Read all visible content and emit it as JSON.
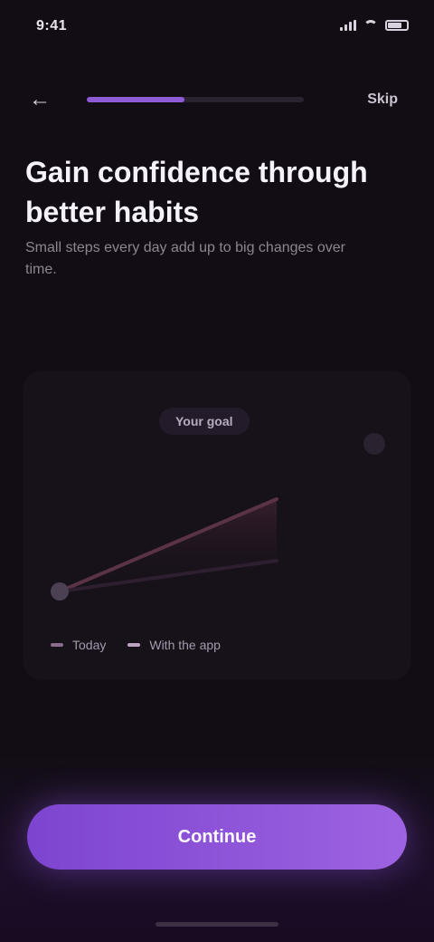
{
  "status_bar": {
    "time": "9:41",
    "icons": [
      "signal-icon",
      "wifi-icon",
      "battery-icon"
    ]
  },
  "header": {
    "back_icon": "arrow-left-icon",
    "progress_fraction": 0.45,
    "skip_label": "Skip"
  },
  "headline": {
    "title": "Gain confidence through better habits",
    "subtitle": "Small steps every day add up to big changes over time."
  },
  "chart": {
    "goal_label": "Your goal",
    "legend": [
      {
        "label": "Today",
        "color": "#8a6c8c"
      },
      {
        "label": "With the app",
        "color": "#b9a5c2"
      }
    ]
  },
  "chart_data": {
    "type": "line",
    "title": "",
    "xlabel": "",
    "ylabel": "",
    "series": [
      {
        "name": "Today",
        "x": [
          0,
          1
        ],
        "y": [
          0.1,
          0.7
        ]
      },
      {
        "name": "With the app",
        "x": [
          0,
          1
        ],
        "y": [
          0.1,
          0.3
        ]
      }
    ],
    "goal_point": {
      "x": 1.45,
      "y": 1.0
    },
    "grid": false,
    "legend_position": "bottom-left",
    "colors": {
      "line": "#5a3346",
      "area": "#3a2130",
      "point": "#4b4152"
    }
  },
  "cta": {
    "label": "Continue"
  },
  "colors": {
    "background": "#120d14",
    "accent": "#8d5bd6",
    "cta_start": "#7d44cf",
    "cta_end": "#9d63e2"
  }
}
